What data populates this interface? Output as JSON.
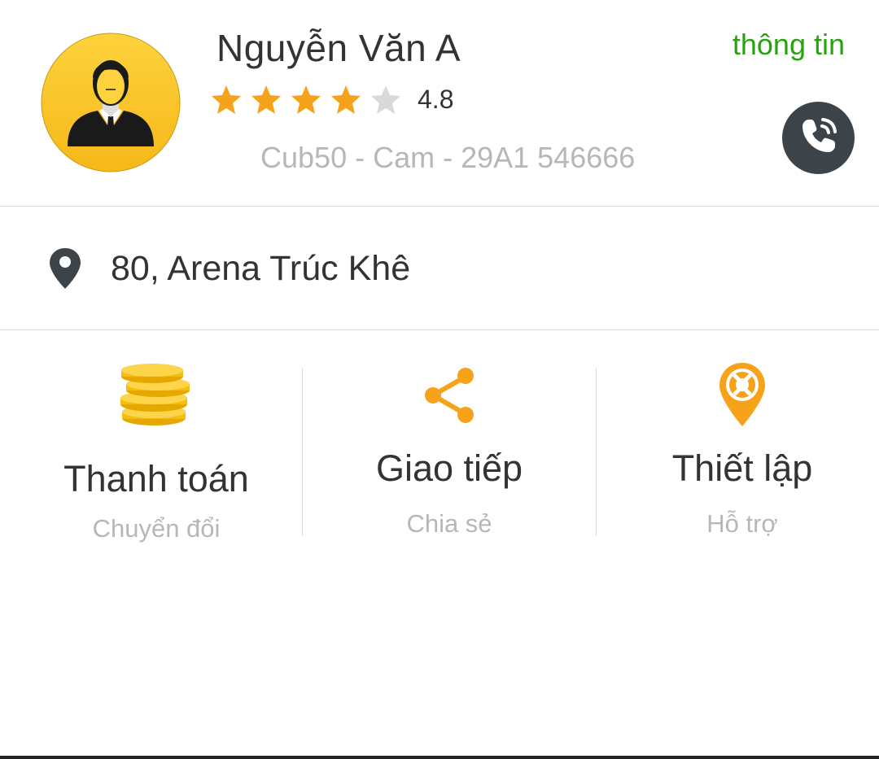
{
  "profile": {
    "name": "Nguyễn Văn A",
    "rating": "4.8",
    "rating_stars": {
      "filled": 4,
      "total": 5
    },
    "vehicle": "Cub50 - Cam - 29A1 546666",
    "info_link": "thông tin",
    "avatar_icon": "driver-avatar-icon",
    "call_icon": "phone-call-icon"
  },
  "address": {
    "icon": "location-pin-icon",
    "text": "80, Arena Trúc Khê"
  },
  "actions": [
    {
      "icon": "coins-icon",
      "title": "Thanh toán",
      "subtitle": "Chuyển đổi"
    },
    {
      "icon": "share-icon",
      "title": "Giao tiếp",
      "subtitle": "Chia sẻ"
    },
    {
      "icon": "support-pin-icon",
      "title": "Thiết lập",
      "subtitle": "Hỗ trợ"
    }
  ],
  "colors": {
    "accent_orange": "#f7a21b",
    "star_filled": "#f7a21b",
    "star_empty": "#d9d9d9",
    "info_green": "#2aa10f",
    "call_button": "#3d4449",
    "avatar_yellow": "#fdc524",
    "text_dark": "#333333",
    "text_muted": "#b7b7b7"
  }
}
